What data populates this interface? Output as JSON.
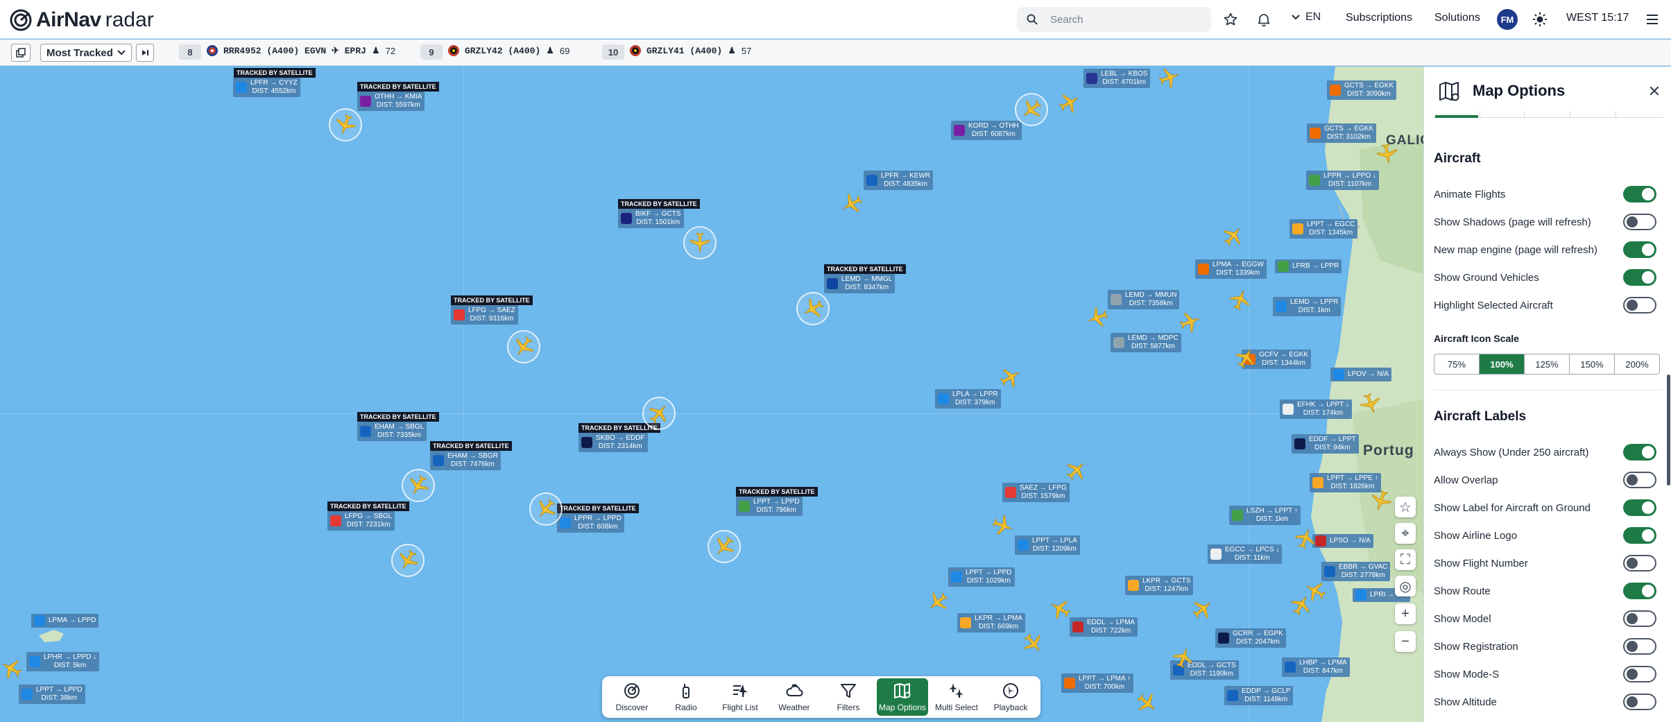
{
  "topbar": {
    "brand_bold": "AirNav",
    "brand_light": " radar",
    "search_placeholder": "Search",
    "language": "EN",
    "subscriptions": "Subscriptions",
    "solutions": "Solutions",
    "avatar": "FM",
    "clock": "WEST 15:17"
  },
  "trackbar": {
    "dropdown": "Most Tracked",
    "items": [
      {
        "rank": "8",
        "text": "RRR4952 (A400) EGVN ✈ EPRJ",
        "viewers": "72",
        "flag": "#1f3c88"
      },
      {
        "rank": "9",
        "text": "GRZLY42 (A400)",
        "viewers": "69",
        "flag": "#d35400"
      },
      {
        "rank": "10",
        "text": "GRZLY41 (A400)",
        "viewers": "57",
        "flag": "#d35400"
      }
    ]
  },
  "map": {
    "satellite_badge": "TRACKED BY SATELLITE",
    "places": [
      "GALIC",
      "Portug"
    ],
    "labels": [
      {
        "route": "LPFR → CYYZ",
        "dist": "DIST: 4552km",
        "logo": "#1e88e5",
        "sat": true
      },
      {
        "route": "OTHH → KMIA",
        "dist": "DIST: 5597km",
        "logo": "#7b1fa2",
        "sat": true
      },
      {
        "route": "BIKF → GCTS",
        "dist": "DIST: 1501km",
        "logo": "#1a237e",
        "sat": true
      },
      {
        "route": "LEMD → MMGL",
        "dist": "DIST: 8347km",
        "logo": "#0d47a1",
        "sat": true
      },
      {
        "route": "LFPG → SAEZ",
        "dist": "DIST: 9316km",
        "logo": "#e53935",
        "sat": true
      },
      {
        "route": "EHAM → SBGL",
        "dist": "DIST: 7335km",
        "logo": "#1565c0",
        "sat": true
      },
      {
        "route": "EHAM → SBGR",
        "dist": "DIST: 7476km",
        "logo": "#1565c0",
        "sat": true
      },
      {
        "route": "SKBO → EDDF",
        "dist": "DIST: 2314km",
        "logo": "#0d1b4c",
        "sat": true
      },
      {
        "route": "LFPG → SBGL",
        "dist": "DIST: 7231km",
        "logo": "#e53935",
        "sat": true
      },
      {
        "route": "LPPR → LPPD",
        "dist": "DIST: 608km",
        "logo": "#1e88e5",
        "sat": true
      },
      {
        "route": "LPPT → LPPD",
        "dist": "DIST: 796km",
        "logo": "#43a047",
        "sat": true
      },
      {
        "route": "LEBL → KBOS",
        "dist": "DIST: 4701km",
        "logo": "#283593",
        "sat": false
      },
      {
        "route": "KORD → OTHH",
        "dist": "DIST: 6087km",
        "logo": "#7b1fa2",
        "sat": false
      },
      {
        "route": "LPFR → KEWR",
        "dist": "DIST: 4835km",
        "logo": "#1565c0",
        "sat": false
      },
      {
        "route": "LEMD → MMUN",
        "dist": "DIST: 7358km",
        "logo": "#90a4ae",
        "sat": false
      },
      {
        "route": "LEMD → MDPC",
        "dist": "DIST: 5877km",
        "logo": "#90a4ae",
        "sat": false
      },
      {
        "route": "LPLA → LPPR",
        "dist": "DIST: 379km",
        "logo": "#1e88e5",
        "sat": false
      },
      {
        "route": "SAEZ → LFPG",
        "dist": "DIST: 1579km",
        "logo": "#e53935",
        "sat": false
      },
      {
        "route": "LPPT → LPLA",
        "dist": "DIST: 1209km",
        "logo": "#1e88e5",
        "sat": false
      },
      {
        "route": "LPPT → LPPD",
        "dist": "DIST: 1029km",
        "logo": "#1e88e5",
        "sat": false
      },
      {
        "route": "LKPR → LPMA",
        "dist": "DIST: 669km",
        "logo": "#f9a825",
        "sat": false
      },
      {
        "route": "EDDL → LPMA",
        "dist": "DIST: 722km",
        "logo": "#c62828",
        "sat": false
      },
      {
        "route": "LKPR → GCTS",
        "dist": "DIST: 1247km",
        "logo": "#f9a825",
        "sat": false
      },
      {
        "route": "LPPT → LPMA ↑",
        "dist": "DIST: 700km",
        "logo": "#ef6c00",
        "sat": false
      },
      {
        "route": "EDDL → GCTS",
        "dist": "DIST: 1190km",
        "logo": "#1565c0",
        "sat": false
      },
      {
        "route": "GCRR → EGPK",
        "dist": "DIST: 2047km",
        "logo": "#0d1b4c",
        "sat": false
      },
      {
        "route": "EDDP → GCLP",
        "dist": "DIST: 1148km",
        "logo": "#1565c0",
        "sat": false
      },
      {
        "route": "LHBP → LPMA",
        "dist": "DIST: 847km",
        "logo": "#1565c0",
        "sat": false
      },
      {
        "route": "LPMA → EGGW",
        "dist": "DIST: 1339km",
        "logo": "#ef6c00",
        "sat": false
      },
      {
        "route": "LFRB → LPPR",
        "dist": "",
        "logo": "#43a047",
        "sat": false
      },
      {
        "route": "LEMD → LPPR",
        "dist": "DIST: 1km",
        "logo": "#1e88e5",
        "sat": false
      },
      {
        "route": "GCFV → EGKK",
        "dist": "DIST: 1344km",
        "logo": "#ef6c00",
        "sat": false
      },
      {
        "route": "EFHK → LPPT ↓",
        "dist": "DIST: 174km",
        "logo": "#eceff1",
        "sat": false
      },
      {
        "route": "EDDF → LPPT",
        "dist": "DIST: 94km",
        "logo": "#0d1b4c",
        "sat": false
      },
      {
        "route": "LPPT → LPPE ↑",
        "dist": "DIST: 1826km",
        "logo": "#f9a825",
        "sat": false
      },
      {
        "route": "LSZH → LPPT ↑",
        "dist": "DIST: 1km",
        "logo": "#43a047",
        "sat": false
      },
      {
        "route": "EGCC → LPCS ↓",
        "dist": "DIST: 11km",
        "logo": "#eceff1",
        "sat": false
      },
      {
        "route": "LPSO → N/A",
        "dist": "",
        "logo": "#c62828",
        "sat": false
      },
      {
        "route": "EBBR → GVAC",
        "dist": "DIST: 2778km",
        "logo": "#1565c0",
        "sat": false
      },
      {
        "route": "LPPR → LPPO ↓",
        "dist": "DIST: 1107km",
        "logo": "#43a047",
        "sat": false
      },
      {
        "route": "LPPT → EGCC",
        "dist": "DIST: 1345km",
        "logo": "#f9a825",
        "sat": false
      },
      {
        "route": "GCTS → EGKK",
        "dist": "DIST: 3090km",
        "logo": "#ef6c00",
        "sat": false
      },
      {
        "route": "GCTS → EGKK",
        "dist": "DIST: 3102km",
        "logo": "#ef6c00",
        "sat": false
      },
      {
        "route": "LPMA → LPPD",
        "dist": "",
        "logo": "#1e88e5",
        "sat": false
      },
      {
        "route": "LPHR → LPPD ↓",
        "dist": "DIST: 5km",
        "logo": "#1e88e5",
        "sat": false
      },
      {
        "route": "LPPT → LPPD",
        "dist": "DIST: 38km",
        "logo": "#1e88e5",
        "sat": false
      },
      {
        "route": "LPOV → N/A",
        "dist": "",
        "logo": "#1e88e5",
        "sat": false
      },
      {
        "route": "LPRI → N/A",
        "dist": "",
        "logo": "#1e88e5",
        "sat": false
      }
    ]
  },
  "bottombar": [
    {
      "label": "Discover",
      "icon": "discover-icon"
    },
    {
      "label": "Radio",
      "icon": "radio-icon"
    },
    {
      "label": "Flight List",
      "icon": "flight-list-icon"
    },
    {
      "label": "Weather",
      "icon": "weather-icon"
    },
    {
      "label": "Filters",
      "icon": "filter-icon"
    },
    {
      "label": "Map Options",
      "icon": "map-options-icon",
      "active": true
    },
    {
      "label": "Multi Select",
      "icon": "multi-select-icon"
    },
    {
      "label": "Playback",
      "icon": "playback-icon"
    }
  ],
  "panel": {
    "title": "Map Options",
    "aircraft_title": "Aircraft",
    "aircraft_toggles": [
      {
        "label": "Animate Flights",
        "on": true
      },
      {
        "label": "Show Shadows (page will refresh)",
        "on": false
      },
      {
        "label": "New map engine (page will refresh)",
        "on": true
      },
      {
        "label": "Show Ground Vehicles",
        "on": true
      },
      {
        "label": "Highlight Selected Aircraft",
        "on": false
      }
    ],
    "scale_title": "Aircraft Icon Scale",
    "scale_options": [
      "75%",
      "100%",
      "125%",
      "150%",
      "200%"
    ],
    "scale_selected": "100%",
    "labels_title": "Aircraft Labels",
    "label_toggles": [
      {
        "label": "Always Show (Under 250 aircraft)",
        "on": true
      },
      {
        "label": "Allow Overlap",
        "on": false
      },
      {
        "label": "Show Label for Aircraft on Ground",
        "on": true
      },
      {
        "label": "Show Airline Logo",
        "on": true
      },
      {
        "label": "Show Flight Number",
        "on": false
      },
      {
        "label": "Show Route",
        "on": true
      },
      {
        "label": "Show Model",
        "on": false
      },
      {
        "label": "Show Registration",
        "on": false
      },
      {
        "label": "Show Mode-S",
        "on": false
      },
      {
        "label": "Show Altitude",
        "on": false
      }
    ]
  },
  "colors": {
    "accent": "#1e7b46",
    "ocean": "#6db8ec",
    "label_bg": "#4a80b0",
    "plane": "#f2c230"
  }
}
